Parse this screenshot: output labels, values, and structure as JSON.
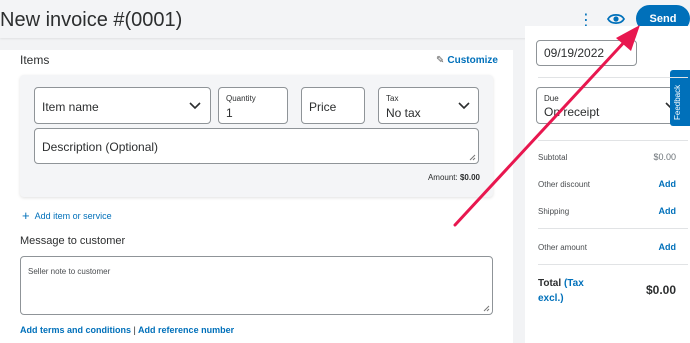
{
  "header": {
    "title": "New invoice #(0001)",
    "more_glyph": "⋮",
    "send_label": "Send"
  },
  "items_section": {
    "title": "Items",
    "customize_label": "Customize",
    "item_name_placeholder": "Item name",
    "quantity_label": "Quantity",
    "quantity_value": "1",
    "price_placeholder": "Price",
    "tax_label": "Tax",
    "tax_value": "No tax",
    "description_placeholder": "Description (Optional)",
    "amount_label": "Amount:",
    "amount_value": "$0.00",
    "add_item_label": "Add item or service"
  },
  "message_section": {
    "title": "Message to customer",
    "placeholder": "Seller note to customer"
  },
  "footer": {
    "terms_link": "Add terms and conditions",
    "separator": "|",
    "reference_link": "Add reference number"
  },
  "sidebar": {
    "date_value": "09/19/2022",
    "due_label": "Due",
    "due_value": "On receipt",
    "feedback_label": "Feedback",
    "subtotal_label": "Subtotal",
    "subtotal_value": "$0.00",
    "other_discount_label": "Other discount",
    "shipping_label": "Shipping",
    "other_amount_label": "Other amount",
    "add_label": "Add",
    "total_label": "Total",
    "tax_excl_label": "(Tax excl.)",
    "total_value": "$0.00"
  },
  "colors": {
    "accent": "#0070ba",
    "annotation_arrow": "#e8174f"
  },
  "icons": [
    "more-vertical-icon",
    "eye-icon",
    "pencil-icon",
    "chevron-down-icon",
    "plus-icon",
    "resize-grip-icon",
    "annotation-arrow"
  ]
}
